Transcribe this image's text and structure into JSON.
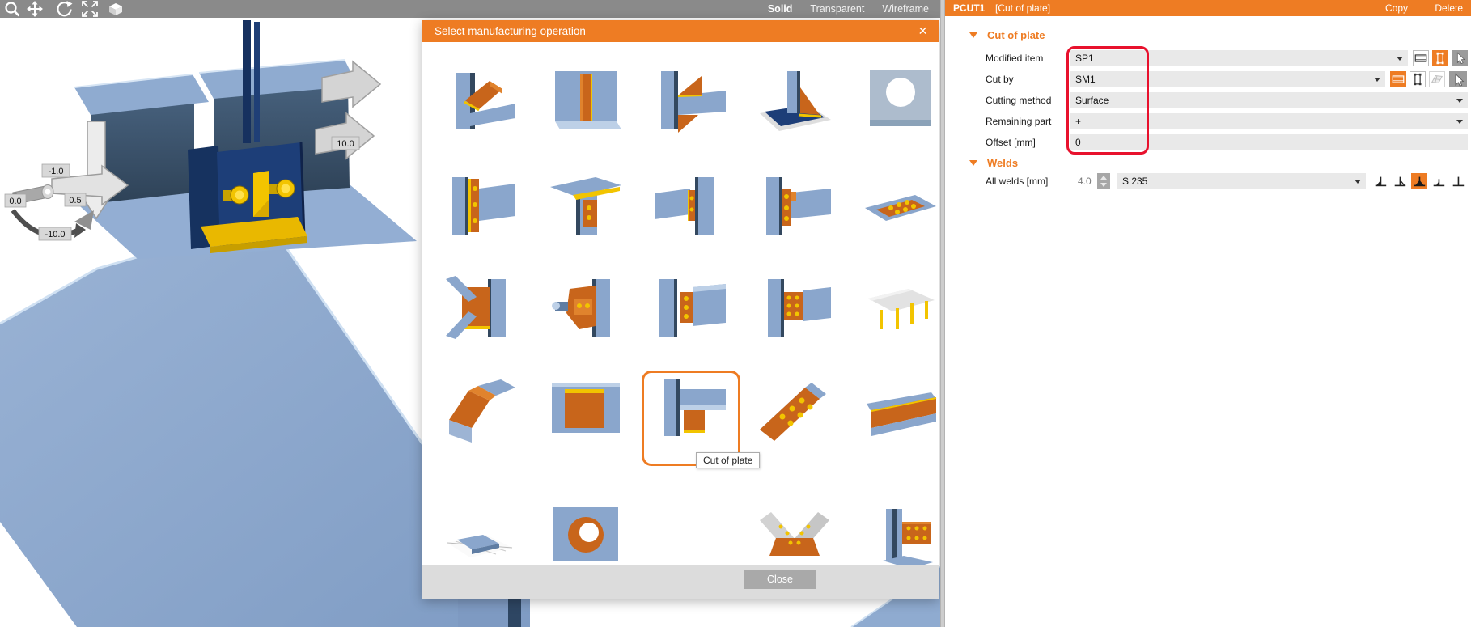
{
  "toolbar": {
    "icons": [
      "zoom-icon",
      "pan-icon",
      "rotate-icon",
      "fit-view-icon",
      "solid-box-icon"
    ],
    "view_modes": [
      {
        "label": "Solid",
        "active": true
      },
      {
        "label": "Transparent",
        "active": false
      },
      {
        "label": "Wireframe",
        "active": false
      }
    ]
  },
  "viewport": {
    "labels": {
      "l1": "-1.0",
      "l2": "0.0",
      "l3": "0.5",
      "l4": "-10.0",
      "l5": "10.0"
    }
  },
  "dialog": {
    "title": "Select manufacturing operation",
    "close_icon": "✕",
    "tooltip": "Cut of plate",
    "close_button": "Close",
    "thumbnails": [
      {
        "name": "cut-of-beam",
        "kind": "cut_beam"
      },
      {
        "name": "stiffener",
        "kind": "stiffener"
      },
      {
        "name": "widener",
        "kind": "widener"
      },
      {
        "name": "rib",
        "kind": "rib"
      },
      {
        "name": "opening",
        "kind": "opening"
      },
      {
        "name": "end-plate",
        "kind": "end_plate"
      },
      {
        "name": "flange-splice-plate",
        "kind": "flange_splice"
      },
      {
        "name": "fin-cleat",
        "kind": "fin_cleat"
      },
      {
        "name": "cleat-bolted",
        "kind": "cleat_bolted"
      },
      {
        "name": "base-plate-bolted",
        "kind": "base_bolted"
      },
      {
        "name": "gusset-plate",
        "kind": "gusset_braces"
      },
      {
        "name": "connecting-plate",
        "kind": "connecting_plate"
      },
      {
        "name": "fin-plate",
        "kind": "fin_plate"
      },
      {
        "name": "splice-plates",
        "kind": "splice_plates"
      },
      {
        "name": "platform",
        "kind": "platform"
      },
      {
        "name": "cut-of-tube",
        "kind": "cut_tube"
      },
      {
        "name": "plate-cut",
        "kind": "plate_rect"
      },
      {
        "name": "cut-of-plate",
        "kind": "cut_of_plate",
        "selected": true
      },
      {
        "name": "bolted-connection",
        "kind": "bolt_grid"
      },
      {
        "name": "wide-plate",
        "kind": "plate_wide"
      },
      {
        "name": "base-grid-plate",
        "kind": "grid_plate"
      },
      {
        "name": "tube-opening",
        "kind": "tube_opening"
      },
      null,
      {
        "name": "truss-gusset",
        "kind": "truss_gusset"
      },
      {
        "name": "bolted-splice",
        "kind": "bolted_splice"
      }
    ]
  },
  "panel": {
    "header": {
      "title": "PCUT1",
      "subtitle": "[Cut of plate]",
      "copy_label": "Copy",
      "delete_label": "Delete"
    },
    "cut_section": {
      "title": "Cut of plate",
      "rows": [
        {
          "label": "Modified item",
          "value": "SP1"
        },
        {
          "label": "Cut by",
          "value": "SM1"
        },
        {
          "label": "Cutting method",
          "value": "Surface"
        },
        {
          "label": "Remaining part",
          "value": "+"
        },
        {
          "label": "Offset [mm]",
          "value": "0"
        }
      ]
    },
    "welds_section": {
      "title": "Welds",
      "row": {
        "label": "All welds [mm]",
        "size": "4.0",
        "material": "S 235"
      }
    },
    "icon_names": {
      "modified_item": [
        "beam-icon",
        "plate-icon",
        "cursor-icon"
      ],
      "cut_by": [
        "beam-icon",
        "plate-icon",
        "mesh-icon",
        "cursor-icon"
      ],
      "welds": [
        "fillet-weld-left-icon",
        "fillet-weld-right-icon",
        "double-fillet-weld-icon",
        "fillet-weld-small-icon",
        "butt-weld-icon"
      ]
    }
  },
  "colors": {
    "accent_orange": "#EE7C23",
    "highlight_red": "#E8112D",
    "steel_blue": "#8CA7CC",
    "bolt_yellow": "#F2C400"
  }
}
